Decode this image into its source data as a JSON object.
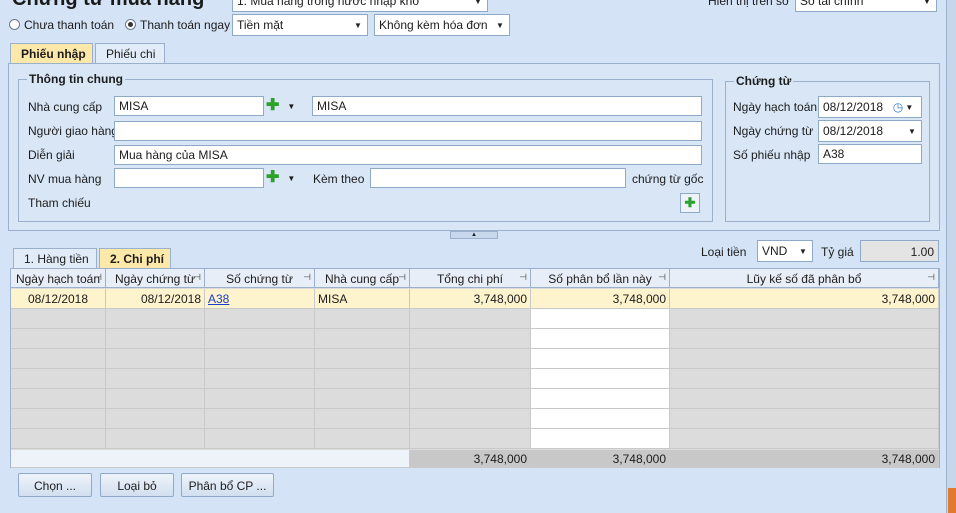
{
  "header": {
    "title": "Chứng từ mua hàng",
    "purchase_type": "1. Mua hàng trong nước nhập kho",
    "view_label": "Hiển thị trên sổ",
    "view_value": "Sổ tài chính"
  },
  "payment": {
    "unpaid_label": "Chưa thanh toán",
    "paid_label": "Thanh toán ngay",
    "method_value": "Tiền mặt",
    "invoice_value": "Không kèm hóa đơn"
  },
  "doc_tabs": [
    "Phiếu nhập",
    "Phiếu chi"
  ],
  "general": {
    "section_title": "Thông tin chung",
    "supplier_label": "Nhà cung cấp",
    "supplier_code": "MISA",
    "supplier_name": "MISA",
    "deliverer_label": "Người giao hàng",
    "deliverer_value": "",
    "description_label": "Diễn giải",
    "description_value": "Mua hàng của MISA",
    "buyer_label": "NV mua hàng",
    "buyer_value": "",
    "attach_label": "Kèm theo",
    "attach_value": "",
    "orig_doc_label": "chứng từ gốc",
    "reference_label": "Tham chiếu"
  },
  "voucher": {
    "section_title": "Chứng từ",
    "posting_date_label": "Ngày hạch toán",
    "posting_date_value": "08/12/2018",
    "doc_date_label": "Ngày chứng từ",
    "doc_date_value": "08/12/2018",
    "receipt_no_label": "Số phiếu nhập",
    "receipt_no_value": "A38"
  },
  "detail_tabs": [
    "1. Hàng tiền",
    "2. Chi phí"
  ],
  "currency": {
    "label": "Loại tiền",
    "value": "VND",
    "rate_label": "Tỷ giá",
    "rate_value": "1.00"
  },
  "grid": {
    "columns": [
      "Ngày hạch toán",
      "Ngày chứng từ",
      "Số chứng từ",
      "Nhà cung cấp",
      "Tổng chi phí",
      "Số phân bổ lần này",
      "Lũy kế số đã phân bổ"
    ],
    "rows": [
      [
        "08/12/2018",
        "08/12/2018",
        "A38",
        "MISA",
        "3,748,000",
        "3,748,000",
        "3,748,000"
      ]
    ],
    "totals": [
      "3,748,000",
      "3,748,000",
      "3,748,000"
    ]
  },
  "buttons": {
    "choose": "Chọn ...",
    "remove": "Loại bỏ",
    "allocate": "Phân bổ CP ..."
  },
  "colors": {
    "background": "#d4e3f5",
    "active_tab": "#fce8a8",
    "selected_row": "#fdf3cd"
  }
}
